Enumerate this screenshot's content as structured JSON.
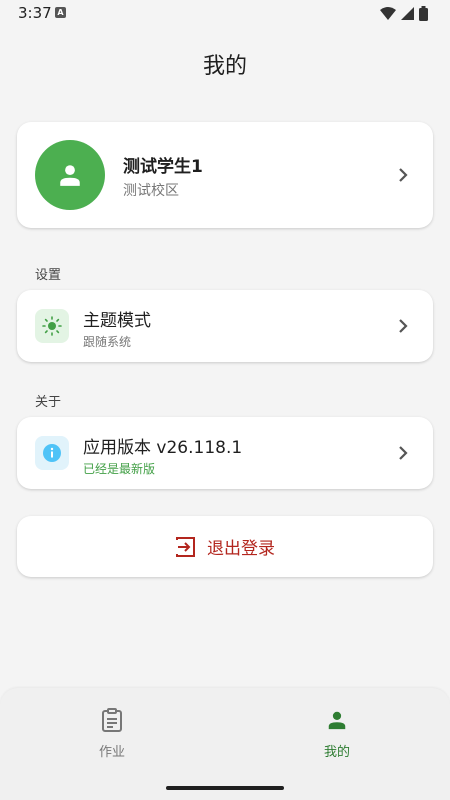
{
  "status_bar": {
    "time": "3:37",
    "notification_icon": "A"
  },
  "header": {
    "title": "我的"
  },
  "profile": {
    "name": "测试学生1",
    "school": "测试校区",
    "avatar_icon": "person-icon"
  },
  "sections": {
    "settings_label": "设置",
    "about_label": "关于"
  },
  "theme": {
    "title": "主题模式",
    "subtitle": "跟随系统",
    "icon": "sun-icon"
  },
  "version": {
    "title": "应用版本 v26.118.1",
    "subtitle": "已经是最新版",
    "icon": "info-icon"
  },
  "logout": {
    "label": "退出登录",
    "icon": "logout-icon"
  },
  "bottom_nav": {
    "items": [
      {
        "label": "作业",
        "icon": "clipboard-icon",
        "active": false
      },
      {
        "label": "我的",
        "icon": "person-icon",
        "active": true
      }
    ]
  },
  "colors": {
    "accent_green": "#4caf50",
    "nav_active": "#2e7d32",
    "nav_inactive": "#777777",
    "version_status": "#43a047",
    "logout": "#b3261e",
    "theme_icon_bg": "#e3f4e4",
    "info_icon_bg": "#e1f3fb"
  }
}
